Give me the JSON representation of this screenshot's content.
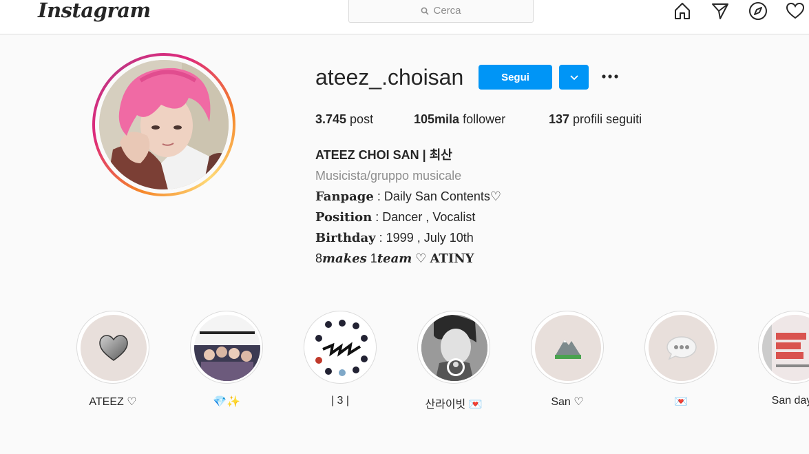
{
  "header": {
    "logo": "Instagram",
    "search_placeholder": "Cerca"
  },
  "profile": {
    "username": "ateez_.choisan",
    "follow_label": "Segui",
    "stats": {
      "posts_value": "3.745",
      "posts_label": " post",
      "followers_value": "105mila",
      "followers_label": " follower",
      "following_value": "137",
      "following_label": " profili seguiti"
    },
    "bio": {
      "name": "ATEEZ CHOI SAN | 최산",
      "category": "Musicista/gruppo musicale",
      "line1_key": "Fanpage",
      "line1_val": " : Daily San Contents♡",
      "line2_key": "Position",
      "line2_val": " : Dancer , Vocalist",
      "line3_key": "Birthday",
      "line3_val": " : 1999 , July 10th",
      "line4_a": "8",
      "line4_b": "makes",
      "line4_c": " 1",
      "line4_d": "team",
      "line4_e": " ♡ ",
      "line4_f": "ATINY"
    }
  },
  "highlights": [
    {
      "label": "ATEEZ ♡"
    },
    {
      "label": "💎✨"
    },
    {
      "label": "| 3 |"
    },
    {
      "label": "산라이빗 💌"
    },
    {
      "label": "San ♡"
    },
    {
      "label": "💌"
    },
    {
      "label": "San days"
    }
  ],
  "colors": {
    "accent": "#0095f6",
    "border": "#dbdbdb",
    "muted": "#8e8e8e",
    "background": "#fafafa"
  }
}
